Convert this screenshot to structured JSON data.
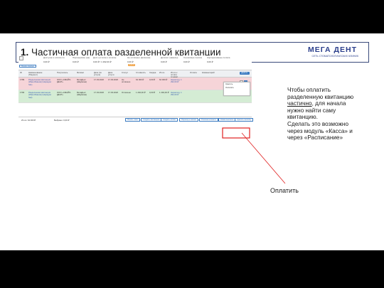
{
  "slide": {
    "title_number": "1.",
    "title_text": "Частичная оплата разделенной квитанции",
    "logo_text": "МЕГА ДЕНТ",
    "logo_subtext": "СЕТЬ СТОМАТОЛОГИЧЕСКИХ КЛИНИК",
    "note_lines": [
      "Чтобы оплатить",
      "разделенную квитанцию",
      "частично",
      ", для начала",
      "нужно найти саму",
      "квитанцию.",
      "Сделать это возможно",
      "через модуль «Касса» и",
      "через  «Расписание»"
    ],
    "callout_label": "Оплатить",
    "callout_color": "#e02020"
  },
  "screenshot": {
    "toolbar": {
      "back_label": "<",
      "fields": [
        {
          "label": "Доступно к оплате по",
          "value": "0,00 ₽",
          "pill": "0,00 ₽"
        },
        {
          "label": "Партнерские (на)",
          "value": "0,00 ₽",
          "pill": "0,00 ₽"
        },
        {
          "label": "Долг (остаток к оплате)",
          "value": "0,00 ₽ / 1 292,00 ₽",
          "pill": "0,00 ₽"
        },
        {
          "label": "Не оплачено (включая)",
          "value": "0,00 ₽",
          "pill": "0,00 ₽"
        },
        {
          "label": "Депозит (авансы)",
          "value": "0,00 ₽",
          "pill": "0,00 ₽"
        },
        {
          "label": "Страховые полиса",
          "value": "0,00 ₽",
          "pill": "0,00 ₽"
        },
        {
          "label": "Корпоративные полиса",
          "value": "0,00 ₽",
          "pill": "0,00 ₽"
        }
      ],
      "print_label": "Печать (кассы)"
    },
    "columns": [
      "ID",
      "Наименование (Пациент)",
      "Получатель",
      "Филиал",
      "Дата (по услуге)",
      "Дата услуги",
      "Статус",
      "Стоимость",
      "Скидка",
      "Итого",
      "Итого к оплате (сумма)",
      "Оплата",
      "Комментарий"
    ],
    "header_button": "Действ.",
    "rows": [
      {
        "id": "1789",
        "name": "Разделенная квитанция (Иван Иванов) (Нарядов №1)",
        "recipient": "ООО «СМАЙЛ-ДЕНТ»",
        "branch": "МегаДент (Шаумяна)",
        "date": "17.03.2020",
        "date2": "17.03.2020",
        "status": "Не оплачено",
        "cost": "64 000 ₽",
        "discount": "0,00 ₽",
        "total": "64 000 ₽",
        "to_pay": "Нерасход. 1 292,00 ₽",
        "pay": "",
        "comment": ""
      },
      {
        "id": "1790",
        "name": "Разделенная квитанция (Иван Иванов) (Нарядов №2)",
        "recipient": "ООО «СМАЙЛ-ДЕНТ»",
        "branch": "МегаДент (Шаумяна)",
        "date": "17.03.2020",
        "date2": "17.03.2020",
        "status": "Оплачено",
        "cost": "1 292,00 ₽",
        "discount": "0,00 ₽",
        "total": "1 292,00 ₽",
        "to_pay": "Нерасход. 1 292,00 ₽",
        "pay": "",
        "comment": ""
      }
    ],
    "dropdown_items": [
      "Удалить",
      "Оплатить"
    ],
    "footer": {
      "total_label": "Итого: 64 000 ₽",
      "selected_label": "Выбрано: 0,00 ₽",
      "buttons": [
        "Печать чека",
        "Создать квитанцию",
        "Создать копию",
        "Переход к записи",
        "Платежи клиента",
        "Новая выписка",
        "Удалить выписку"
      ]
    }
  }
}
